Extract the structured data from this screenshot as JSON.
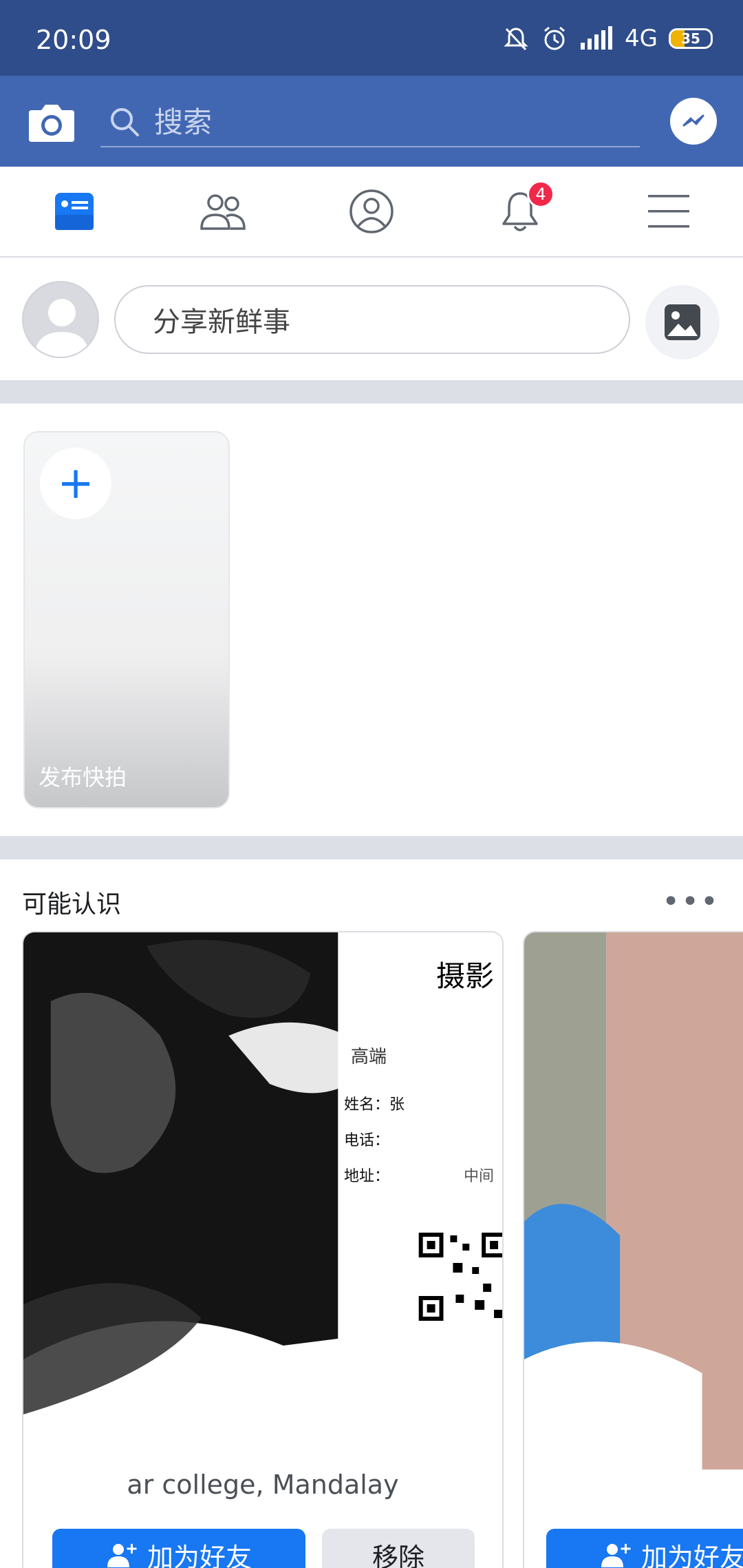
{
  "status": {
    "time": "20:09",
    "network": "4G",
    "battery": {
      "level_percent": 35,
      "label": "35"
    }
  },
  "header": {
    "search_placeholder": "搜索"
  },
  "tabs": [
    {
      "name": "feed",
      "icon": "news-feed-icon",
      "active": true
    },
    {
      "name": "friends",
      "icon": "friends-icon"
    },
    {
      "name": "profile",
      "icon": "profile-icon"
    },
    {
      "name": "notifications",
      "icon": "bell-icon",
      "badge": "4"
    },
    {
      "name": "menu",
      "icon": "menu-icon"
    }
  ],
  "composer": {
    "prompt": "分享新鲜事"
  },
  "stories": {
    "create_label": "发布快拍",
    "add_symbol": "+"
  },
  "pymk": {
    "title": "可能认识",
    "more": "•••",
    "cards": [
      {
        "subtitle": "ar college, Mandalay",
        "add_label": "加为好友",
        "remove_label": "移除",
        "photo_text": {
          "heading": "摄影",
          "line1": "高端",
          "name": "姓名：张",
          "phone": "电话：",
          "address": "地址：",
          "address_tail": "中间"
        }
      },
      {
        "add_label": "加为好友"
      }
    ]
  },
  "colors": {
    "statusbar": "#2f4d8a",
    "header": "#4267b2",
    "accent": "#1877f2",
    "badge": "#f02849"
  }
}
